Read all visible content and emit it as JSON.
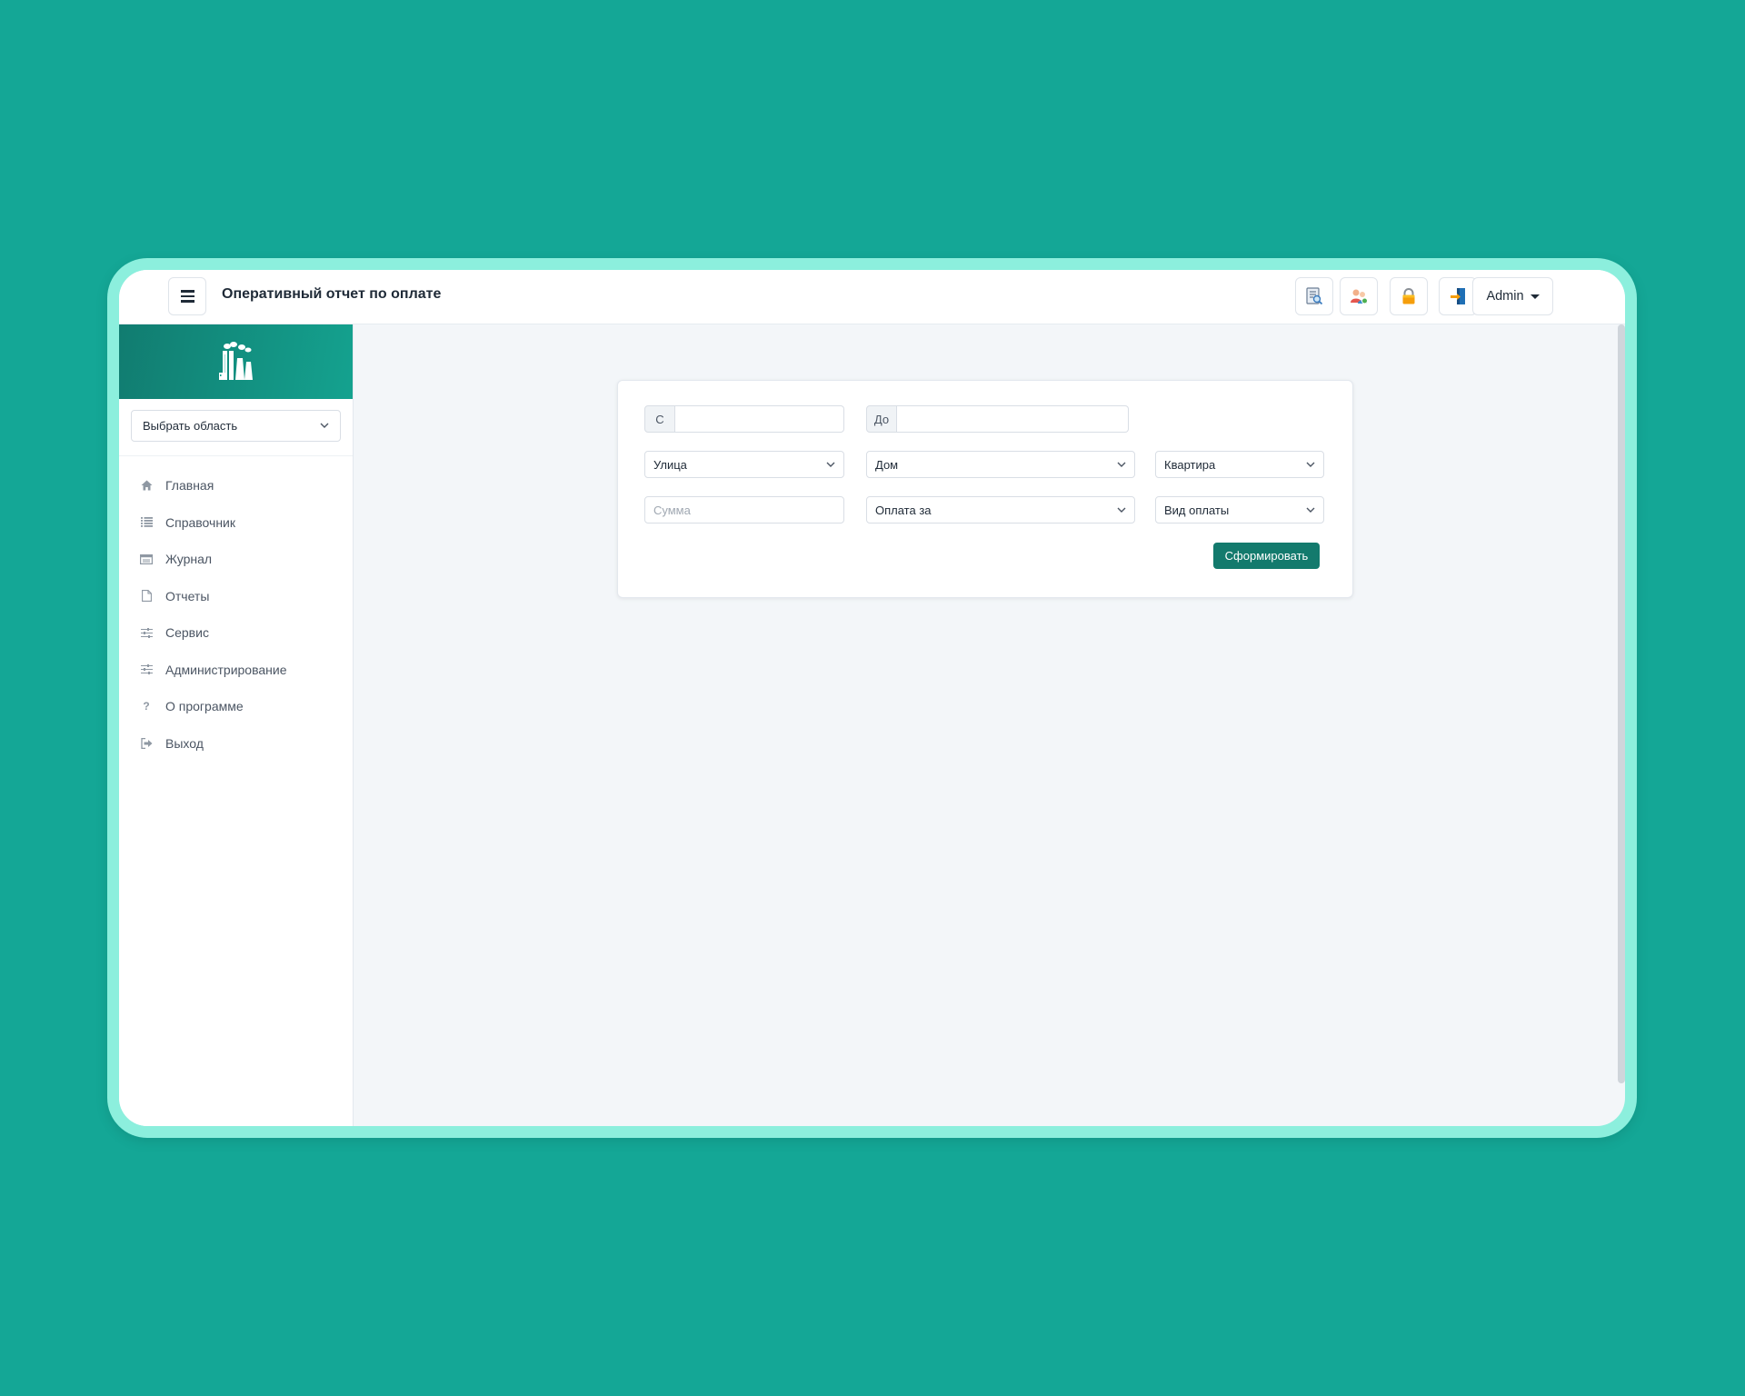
{
  "header": {
    "title": "Оперативный отчет по оплате",
    "menu_icon": "hamburger-icon",
    "tools": [
      {
        "name": "report-search-icon"
      },
      {
        "name": "users-icon"
      },
      {
        "name": "lock-icon"
      },
      {
        "name": "exit-door-icon"
      }
    ],
    "user_label": "Admin"
  },
  "sidebar": {
    "logo": "factory-icon",
    "area_select": "Выбрать область",
    "items": [
      {
        "label": "Главная",
        "icon": "home-icon"
      },
      {
        "label": "Справочник",
        "icon": "list-icon"
      },
      {
        "label": "Журнал",
        "icon": "journal-icon"
      },
      {
        "label": "Отчеты",
        "icon": "document-icon"
      },
      {
        "label": "Сервис",
        "icon": "sliders-icon"
      },
      {
        "label": "Администрирование",
        "icon": "sliders-icon"
      },
      {
        "label": "О программе",
        "icon": "question-icon"
      },
      {
        "label": "Выход",
        "icon": "sign-out-icon"
      }
    ]
  },
  "form": {
    "from_label": "С",
    "from_value": "",
    "to_label": "До",
    "to_value": "",
    "street": "Улица",
    "house": "Дом",
    "apartment": "Квартира",
    "sum_placeholder": "Сумма",
    "payment_for": "Оплата за",
    "payment_type": "Вид оплаты",
    "submit": "Сформировать"
  },
  "colors": {
    "background": "#14a796",
    "frame": "#8cefdd",
    "brand": "#117c70",
    "primary_button": "#137a6d"
  }
}
